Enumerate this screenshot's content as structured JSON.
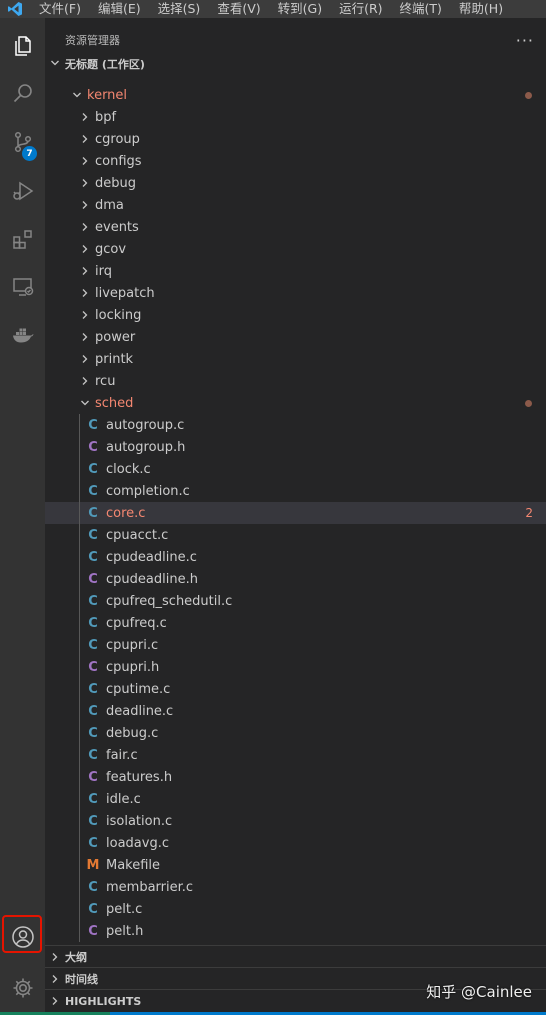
{
  "menu": [
    "文件(F)",
    "编辑(E)",
    "选择(S)",
    "查看(V)",
    "转到(G)",
    "运行(R)",
    "终端(T)",
    "帮助(H)"
  ],
  "activity": {
    "scm_badge": "7"
  },
  "sidebar": {
    "title": "资源管理器",
    "more": "···",
    "workspace": "无标题 (工作区)"
  },
  "tree": {
    "kernel": "kernel",
    "folders": [
      "bpf",
      "cgroup",
      "configs",
      "debug",
      "dma",
      "events",
      "gcov",
      "irq",
      "livepatch",
      "locking",
      "power",
      "printk",
      "rcu"
    ],
    "sched": "sched",
    "files": [
      {
        "name": "autogroup.c",
        "type": "c"
      },
      {
        "name": "autogroup.h",
        "type": "h"
      },
      {
        "name": "clock.c",
        "type": "c"
      },
      {
        "name": "completion.c",
        "type": "c"
      },
      {
        "name": "core.c",
        "type": "c",
        "selected": true,
        "problems": "2"
      },
      {
        "name": "cpuacct.c",
        "type": "c"
      },
      {
        "name": "cpudeadline.c",
        "type": "c"
      },
      {
        "name": "cpudeadline.h",
        "type": "h"
      },
      {
        "name": "cpufreq_schedutil.c",
        "type": "c"
      },
      {
        "name": "cpufreq.c",
        "type": "c"
      },
      {
        "name": "cpupri.c",
        "type": "c"
      },
      {
        "name": "cpupri.h",
        "type": "h"
      },
      {
        "name": "cputime.c",
        "type": "c"
      },
      {
        "name": "deadline.c",
        "type": "c"
      },
      {
        "name": "debug.c",
        "type": "c"
      },
      {
        "name": "fair.c",
        "type": "c"
      },
      {
        "name": "features.h",
        "type": "h"
      },
      {
        "name": "idle.c",
        "type": "c"
      },
      {
        "name": "isolation.c",
        "type": "c"
      },
      {
        "name": "loadavg.c",
        "type": "c"
      },
      {
        "name": "Makefile",
        "type": "m"
      },
      {
        "name": "membarrier.c",
        "type": "c"
      },
      {
        "name": "pelt.c",
        "type": "c"
      },
      {
        "name": "pelt.h",
        "type": "h"
      }
    ],
    "icon_letters": {
      "c": "C",
      "h": "C",
      "m": "M"
    }
  },
  "panels": {
    "outline": "大纲",
    "timeline": "时间线",
    "highlights": "HIGHLIGHTS"
  },
  "watermark": "知乎 @Cainlee",
  "colors": {
    "accent": "#007acc",
    "modified": "#f48771",
    "c_icon": "#519aba",
    "h_icon": "#a074c4",
    "makefile_icon": "#e37933",
    "highlight_box": "#e51400"
  }
}
